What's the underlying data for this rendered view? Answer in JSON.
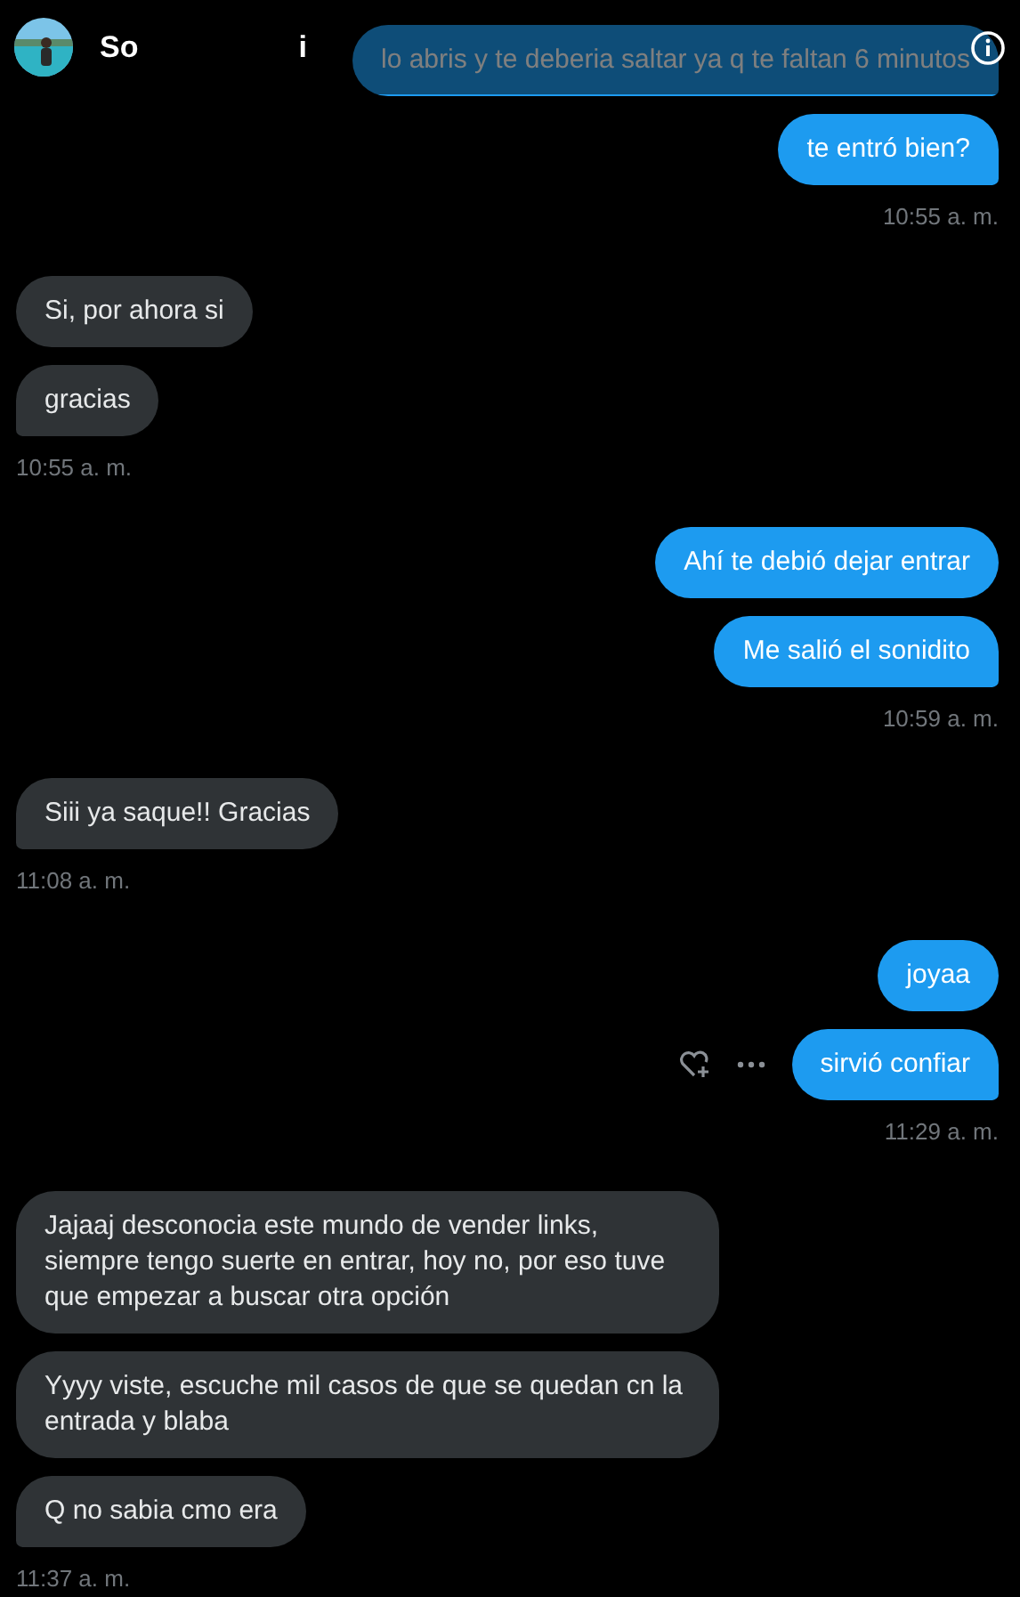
{
  "header": {
    "name": "So",
    "name_tail": "i"
  },
  "groups": [
    {
      "kind": "outgoing",
      "messages": [
        {
          "text": "lo abris y te deberia saltar ya q te faltan 6 minutos",
          "hover_actions": false
        }
      ]
    },
    {
      "kind": "outgoing",
      "messages": [
        {
          "text": "te entró bien?",
          "hover_actions": false
        }
      ],
      "time": "10:55 a. m."
    },
    {
      "kind": "incoming",
      "messages": [
        {
          "text": "Si, por ahora si",
          "hover_actions": false
        },
        {
          "text": "gracias",
          "hover_actions": false
        }
      ],
      "time": "10:55 a. m."
    },
    {
      "kind": "outgoing",
      "messages": [
        {
          "text": "Ahí te debió dejar entrar",
          "hover_actions": false
        },
        {
          "text": "Me salió el sonidito",
          "hover_actions": false
        }
      ],
      "time": "10:59 a. m."
    },
    {
      "kind": "incoming",
      "messages": [
        {
          "text": "Siii ya saque!! Gracias",
          "hover_actions": false
        }
      ],
      "time": "11:08 a. m."
    },
    {
      "kind": "outgoing",
      "messages": [
        {
          "text": "joyaa",
          "hover_actions": false
        },
        {
          "text": "sirvió confiar",
          "hover_actions": true
        }
      ],
      "time": "11:29 a. m."
    },
    {
      "kind": "incoming",
      "messages": [
        {
          "text": "Jajaaj desconocia este mundo de vender links, siempre tengo suerte en entrar, hoy no, por eso tuve que empezar a buscar otra opción",
          "hover_actions": false
        },
        {
          "text": "Yyyy viste, escuche mil casos de que se quedan cn la entrada y blaba",
          "hover_actions": false
        },
        {
          "text": "Q no sabia cmo era",
          "hover_actions": false
        }
      ],
      "time": "11:37 a. m."
    }
  ]
}
